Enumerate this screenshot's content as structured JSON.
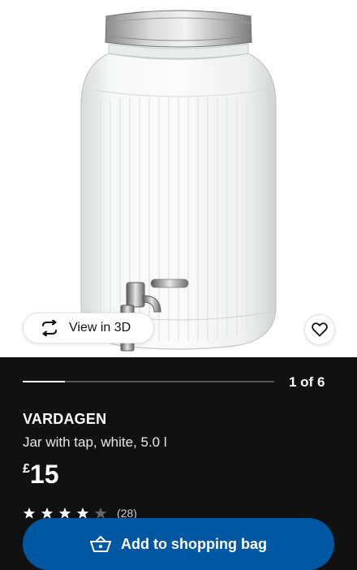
{
  "gallery": {
    "image_icon": "glass-drink-dispenser-image",
    "view3d_label": "View in 3D",
    "view3d_icon": "rotate-3d-icon",
    "favourite_icon": "heart-icon",
    "counter": "1 of 6",
    "current": 1,
    "total": 6
  },
  "product": {
    "name": "VARDAGEN",
    "description": "Jar with tap, white, 5.0 l",
    "currency": "£",
    "price": "15",
    "rating_stars": 4,
    "rating_max": 5,
    "review_count": "(28)"
  },
  "actions": {
    "add_to_bag_label": "Add to shopping bag",
    "add_to_bag_icon": "shopping-bag-icon"
  },
  "colors": {
    "background": "#111111",
    "primary_button": "#0058a3",
    "text": "#ffffff"
  }
}
